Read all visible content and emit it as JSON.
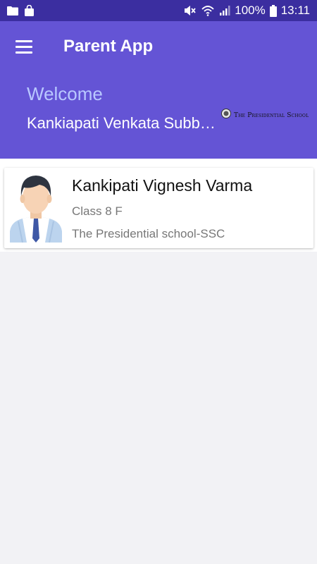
{
  "status_bar": {
    "battery": "100%",
    "time": "13:11",
    "icons": [
      "folder-icon",
      "bag-icon",
      "mute-icon",
      "wifi-icon",
      "signal-icon",
      "battery-icon"
    ]
  },
  "header": {
    "title": "Parent App",
    "welcome": "Welcome",
    "parent_name": "Kankiapati Venkata Subbaraju",
    "school_logo_text": "The Presidential School"
  },
  "students": [
    {
      "name": "Kankipati Vignesh Varma",
      "class": "Class 8 F",
      "school": "The Presidential school-SSC"
    }
  ],
  "colors": {
    "status_bar": "#3b2ea0",
    "header": "#6454d5",
    "welcome": "#b9c8ff",
    "background": "#f2f2f5"
  }
}
